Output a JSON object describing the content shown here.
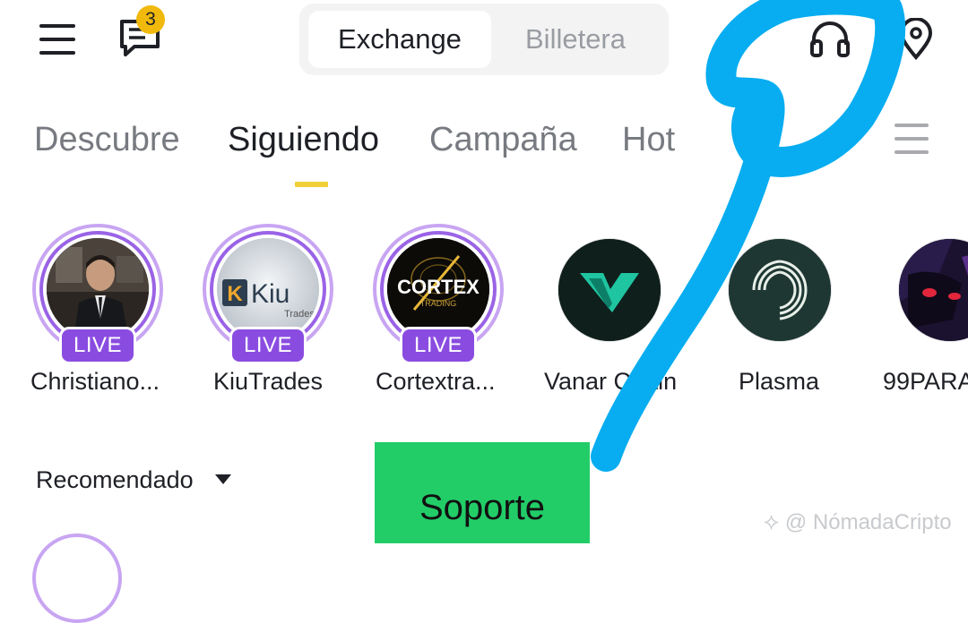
{
  "header": {
    "notifications_count": "3",
    "segment": {
      "active": "Exchange",
      "inactive": "Billetera"
    }
  },
  "tabs": [
    {
      "label": "Descubre",
      "active": false
    },
    {
      "label": "Siguiendo",
      "active": true
    },
    {
      "label": "Campaña",
      "active": false
    },
    {
      "label": "Hot",
      "active": false
    }
  ],
  "following": [
    {
      "name": "Christiano...",
      "live": true,
      "live_label": "LIVE"
    },
    {
      "name": "KiuTrades",
      "live": true,
      "live_label": "LIVE",
      "logo_text": "Kiu",
      "logo_sub": "Trades"
    },
    {
      "name": "Cortextra...",
      "live": true,
      "live_label": "LIVE",
      "logo_text": "CORTEX",
      "logo_sub": "TRADING"
    },
    {
      "name": "Vanar Chain",
      "live": false
    },
    {
      "name": "Plasma",
      "live": false
    },
    {
      "name": "99PARA",
      "live": false
    }
  ],
  "recommended": {
    "label": "Recomendado"
  },
  "support_button": {
    "label": "Soporte"
  },
  "watermark": {
    "text": "@ NómadaCripto"
  },
  "colors": {
    "accent_yellow": "#f0b90b",
    "live_purple": "#8a4ce0",
    "support_green": "#22cd68",
    "scribble_blue": "#07adf0"
  }
}
